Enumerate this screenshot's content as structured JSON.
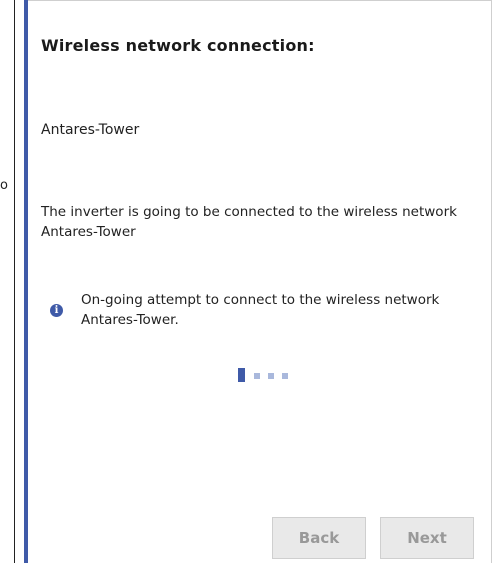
{
  "edge_fragment": "o",
  "wizard": {
    "heading": "Wireless network connection:",
    "network_name": "Antares-Tower",
    "description": "The inverter is going to be connected to the wireless network Antares-Tower",
    "info": {
      "icon": "info-icon",
      "icon_glyph": "i",
      "text": "On-going attempt to connect to the wireless network Antares-Tower."
    },
    "loader": {
      "icon": "loading-indicator",
      "segments": 4
    },
    "buttons": {
      "back_label": "Back",
      "next_label": "Next"
    }
  },
  "colors": {
    "accent": "#3f5aa8",
    "loader_dim": "#a9b8dc",
    "button_bg": "#e9e9e9",
    "button_text_disabled": "#999999"
  }
}
